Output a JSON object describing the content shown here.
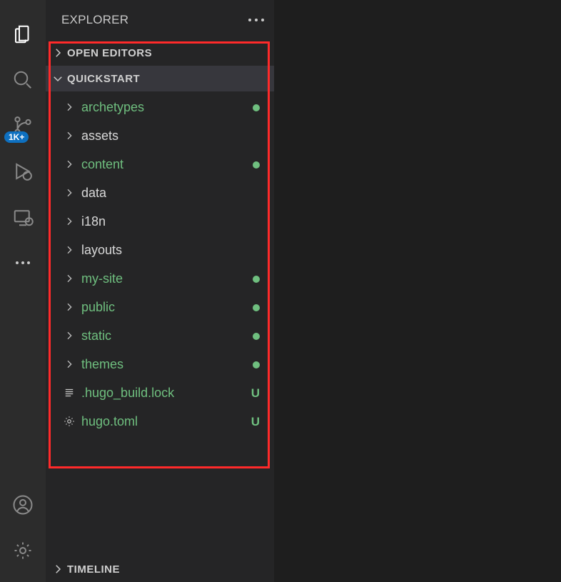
{
  "panel": {
    "title": "EXPLORER"
  },
  "sections": {
    "openEditors": {
      "label": "OPEN EDITORS"
    },
    "workspace": {
      "label": "QUICKSTART"
    },
    "timeline": {
      "label": "TIMELINE"
    }
  },
  "scmBadge": "1K+",
  "tree": {
    "items": [
      {
        "type": "folder",
        "label": "archetypes",
        "color": "green",
        "status": "dot"
      },
      {
        "type": "folder",
        "label": "assets",
        "color": "white",
        "status": ""
      },
      {
        "type": "folder",
        "label": "content",
        "color": "green",
        "status": "dot"
      },
      {
        "type": "folder",
        "label": "data",
        "color": "white",
        "status": ""
      },
      {
        "type": "folder",
        "label": "i18n",
        "color": "white",
        "status": ""
      },
      {
        "type": "folder",
        "label": "layouts",
        "color": "white",
        "status": ""
      },
      {
        "type": "folder",
        "label": "my-site",
        "color": "green",
        "status": "dot"
      },
      {
        "type": "folder",
        "label": "public",
        "color": "green",
        "status": "dot"
      },
      {
        "type": "folder",
        "label": "static",
        "color": "green",
        "status": "dot"
      },
      {
        "type": "folder",
        "label": "themes",
        "color": "green",
        "status": "dot"
      },
      {
        "type": "file",
        "label": ".hugo_build.lock",
        "icon": "lines",
        "color": "green",
        "status": "U"
      },
      {
        "type": "file",
        "label": "hugo.toml",
        "icon": "gear",
        "color": "green",
        "status": "U"
      }
    ]
  }
}
